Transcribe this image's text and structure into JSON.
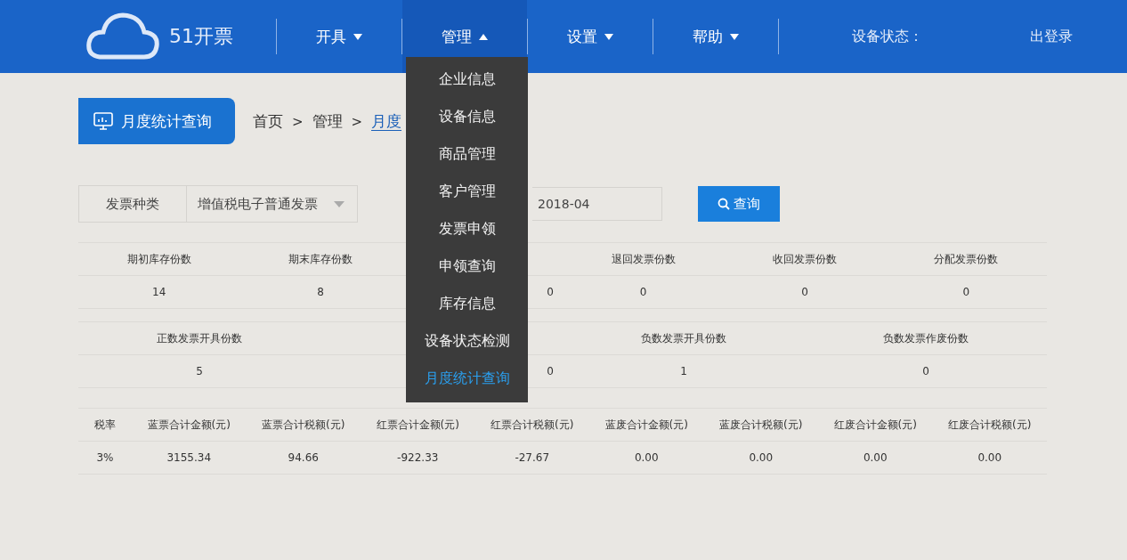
{
  "header": {
    "logo_text": "51开票",
    "nav": [
      {
        "label": "开具",
        "expanded": false
      },
      {
        "label": "管理",
        "expanded": true
      },
      {
        "label": "设置",
        "expanded": false
      },
      {
        "label": "帮助",
        "expanded": false
      }
    ],
    "status_label": "设备状态：",
    "logout": "出登录"
  },
  "menu": [
    {
      "label": "企业信息",
      "selected": false
    },
    {
      "label": "设备信息",
      "selected": false
    },
    {
      "label": "商品管理",
      "selected": false
    },
    {
      "label": "客户管理",
      "selected": false
    },
    {
      "label": "发票申领",
      "selected": false
    },
    {
      "label": "申领查询",
      "selected": false
    },
    {
      "label": "库存信息",
      "selected": false
    },
    {
      "label": "设备状态检测",
      "selected": false
    },
    {
      "label": "月度统计查询",
      "selected": true
    }
  ],
  "page_title": "月度统计查询",
  "breadcrumb": [
    "首页",
    "管理",
    "月度"
  ],
  "breadcrumb_separator": ">",
  "filter": {
    "type_label": "发票种类",
    "type_value": "增值税电子普通发票",
    "month_value": "2018-04",
    "query_button": "查询"
  },
  "stock_table": {
    "columns": [
      "期初库存份数",
      "期末库存份数",
      "",
      "退回发票份数",
      "收回发票份数",
      "分配发票份数"
    ],
    "values": [
      "14",
      "8",
      "0",
      "0",
      "0",
      "0"
    ]
  },
  "issue_table": {
    "columns": [
      "正数发票开具份数",
      "",
      "负数发票开具份数",
      "负数发票作废份数"
    ],
    "values": [
      "5",
      "0",
      "1",
      "0"
    ]
  },
  "amount_table": {
    "columns": [
      "税率",
      "蓝票合计金额(元)",
      "蓝票合计税额(元)",
      "红票合计金额(元)",
      "红票合计税额(元)",
      "蓝废合计金额(元)",
      "蓝废合计税额(元)",
      "红废合计金额(元)",
      "红废合计税额(元)"
    ],
    "values": [
      "3%",
      "3155.34",
      "94.66",
      "-922.33",
      "-27.67",
      "0.00",
      "0.00",
      "0.00",
      "0.00"
    ]
  }
}
